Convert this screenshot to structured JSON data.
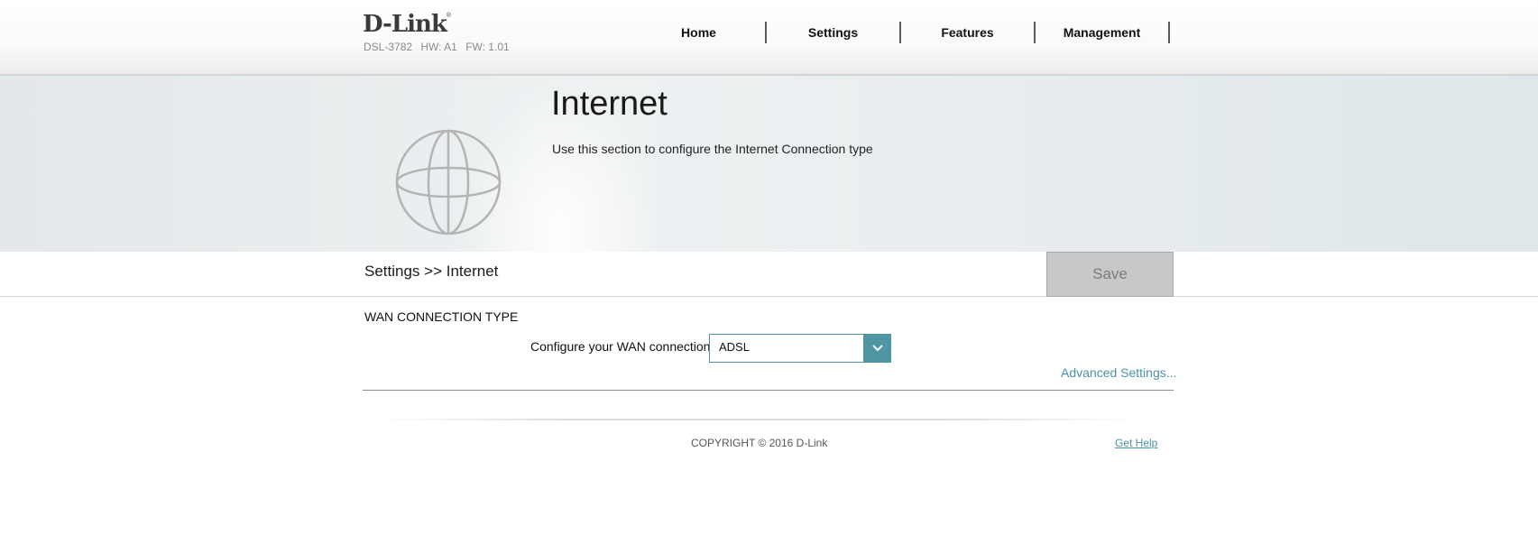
{
  "header": {
    "brand": "D-Link",
    "model": "DSL-3782",
    "hw": "HW: A1",
    "fw": "FW: 1.01"
  },
  "nav": {
    "items": [
      {
        "label": "Home"
      },
      {
        "label": "Settings"
      },
      {
        "label": "Features"
      },
      {
        "label": "Management"
      }
    ]
  },
  "hero": {
    "icon": "globe-icon",
    "title": "Internet",
    "description": "Use this section to configure the Internet Connection type"
  },
  "breadcrumb": {
    "text": "Settings >> Internet",
    "save_label": "Save"
  },
  "wan": {
    "section_title": "WAN CONNECTION TYPE",
    "label": "Configure your WAN connection:",
    "selected": "ADSL",
    "advanced_link": "Advanced Settings..."
  },
  "footer": {
    "copyright": "COPYRIGHT © 2016 D-Link",
    "help": "Get Help"
  },
  "colors": {
    "accent": "#4f95a3",
    "link": "#4a93a5",
    "save_disabled": "#c8c8c8"
  }
}
